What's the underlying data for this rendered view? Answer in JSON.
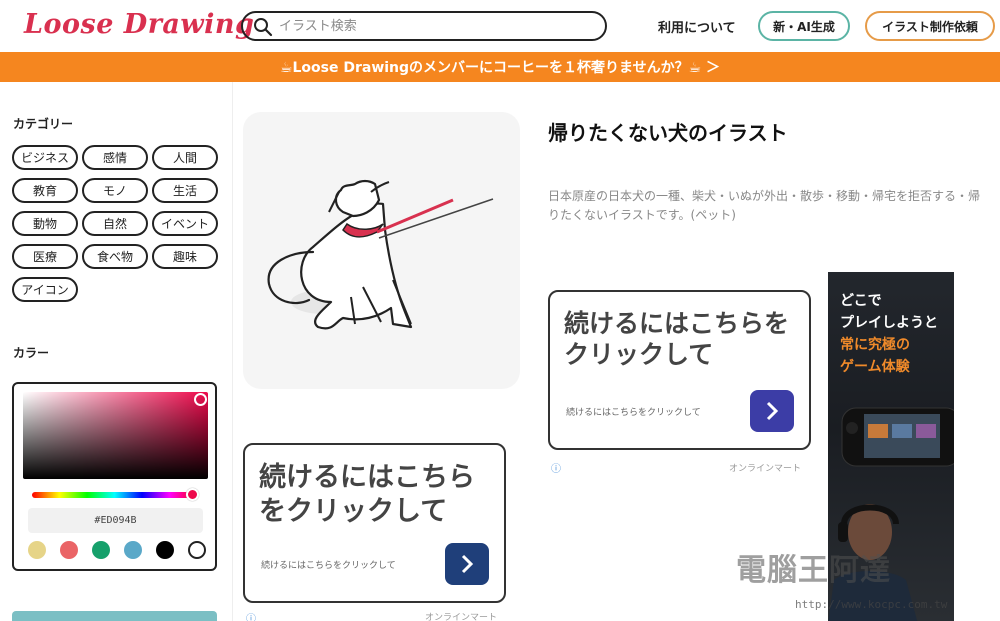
{
  "header": {
    "logo": "Loose Drawing",
    "search_placeholder": "イラスト検索",
    "about_link": "利用について",
    "ai_button": "新・AI生成",
    "request_button": "イラスト制作依頼"
  },
  "banner": {
    "text": "☕Loose Drawingのメンバーにコーヒーを１杯奢りませんか？☕ ＞"
  },
  "sidebar": {
    "category_title": "カテゴリー",
    "categories": [
      "ビジネス",
      "感情",
      "人間",
      "教育",
      "モノ",
      "生活",
      "動物",
      "自然",
      "イベント",
      "医療",
      "食べ物",
      "趣味",
      "アイコン"
    ],
    "color_title": "カラー",
    "hex_value": "#ED094B",
    "swatches": [
      "#e6d488",
      "#ea6466",
      "#16a06b",
      "#5aa8c8",
      "#000000",
      "#ffffff"
    ]
  },
  "main": {
    "title": "帰りたくない犬のイラスト",
    "description": "日本原産の日本犬の一種、柴犬・いぬが外出・散歩・移動・帰宅を拒否する・帰りたくないイラストです。(ペット)"
  },
  "ads": {
    "headline": "続けるにはこちらをクリックして",
    "subtext": "続けるにはこちらをクリックして",
    "footer": "オンラインマート",
    "info_icon": "ⓘ",
    "game_lines": [
      "どこで",
      "プレイしようと",
      "常に究極の",
      "ゲーム体験"
    ]
  },
  "watermark": {
    "text": "電腦王阿達",
    "url": "http://www.kocpc.com.tw"
  }
}
